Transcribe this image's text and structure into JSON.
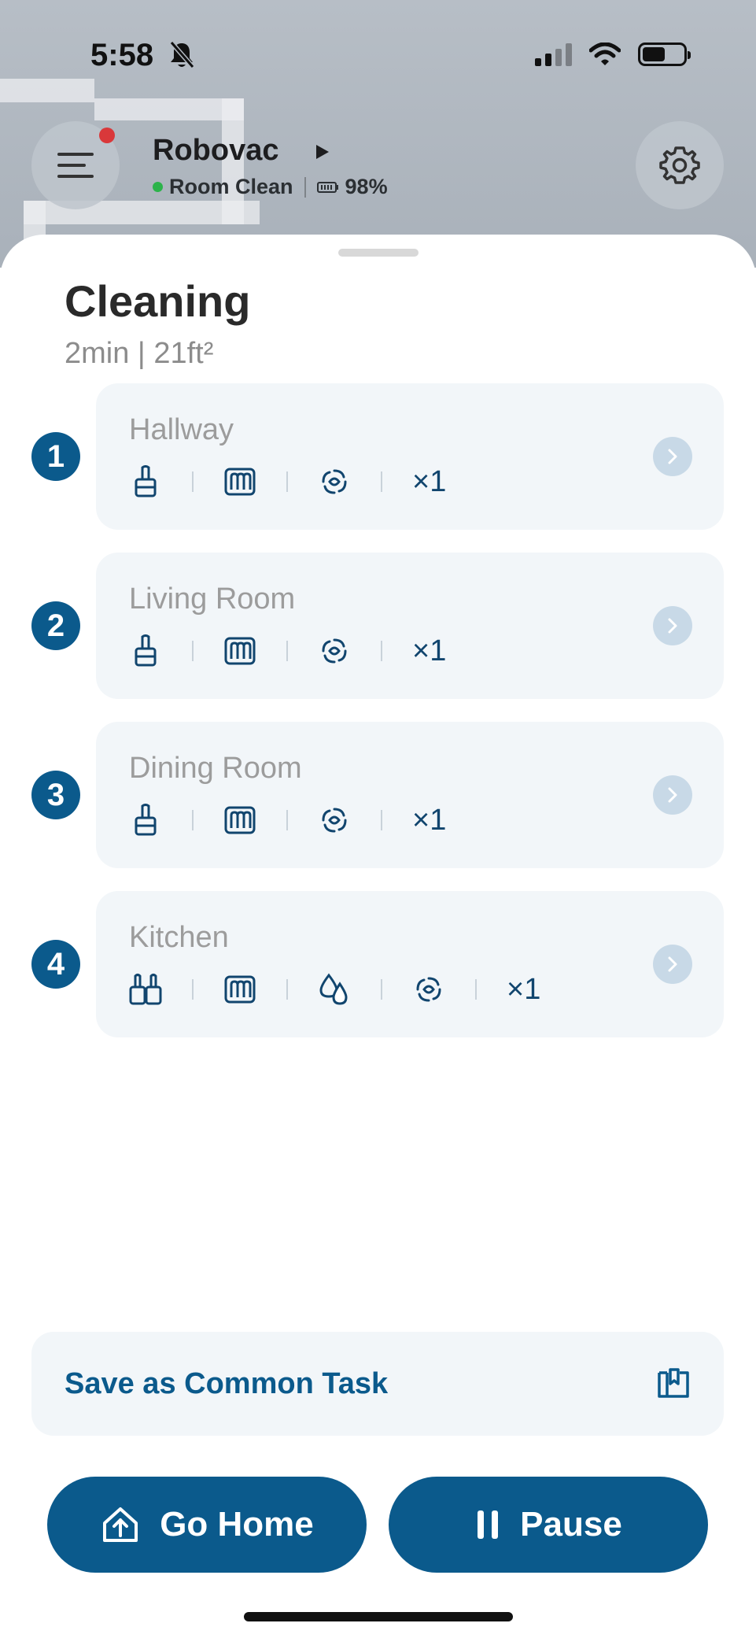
{
  "status_bar": {
    "time": "5:58",
    "icons": [
      "bell-slash-icon",
      "cellular-signal-icon",
      "wifi-icon",
      "battery-icon"
    ]
  },
  "header": {
    "device_name": "Robovac",
    "mode": "Room Clean",
    "battery": "98%",
    "icons": [
      "menu-icon",
      "play-icon",
      "battery-small-icon",
      "gear-icon"
    ]
  },
  "task": {
    "title": "Cleaning",
    "summary": "2min | 21ft²"
  },
  "rooms": [
    {
      "number": "1",
      "name": "Hallway",
      "icons": [
        "brush-icon",
        "mop-icon",
        "fan-icon"
      ],
      "times": "×1"
    },
    {
      "number": "2",
      "name": "Living Room",
      "icons": [
        "brush-icon",
        "mop-icon",
        "fan-icon"
      ],
      "times": "×1"
    },
    {
      "number": "3",
      "name": "Dining Room",
      "icons": [
        "brush-icon",
        "mop-icon",
        "fan-icon"
      ],
      "times": "×1"
    },
    {
      "number": "4",
      "name": "Kitchen",
      "icons": [
        "double-brush-icon",
        "mop-icon",
        "water-drops-icon",
        "fan-icon"
      ],
      "times": "×1"
    }
  ],
  "save_task": {
    "label": "Save as Common Task",
    "icon": "bookmark-map-icon"
  },
  "actions": {
    "home_label": "Go Home",
    "pause_label": "Pause"
  },
  "colors": {
    "accent": "#0b5a8c",
    "card_bg": "#f2f6f9",
    "status_online": "#2cb34a",
    "notification": "#d9383a"
  }
}
